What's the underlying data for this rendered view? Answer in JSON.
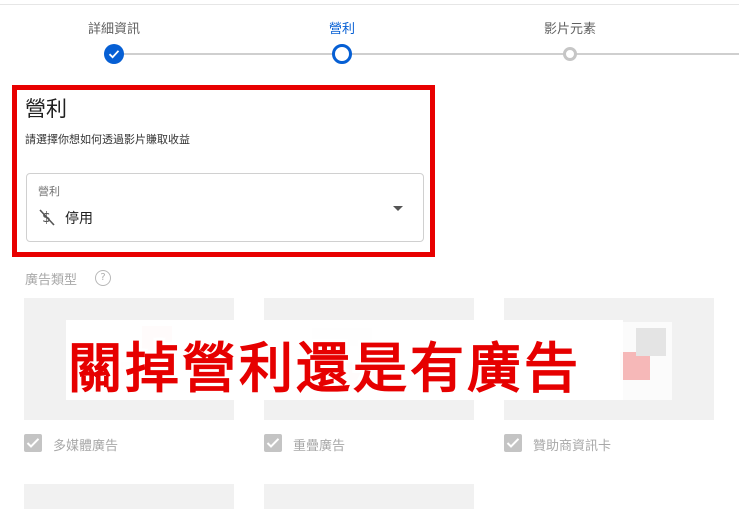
{
  "stepper": {
    "steps": [
      {
        "label": "詳細資訊",
        "state": "done"
      },
      {
        "label": "營利",
        "state": "current"
      },
      {
        "label": "影片元素",
        "state": "todo"
      }
    ]
  },
  "monetization": {
    "title": "營利",
    "description": "請選擇你想如何透過影片賺取收益",
    "select": {
      "label": "營利",
      "value": "停用",
      "icon": "monetization-off-icon"
    }
  },
  "ad_types": {
    "label": "廣告類型",
    "help_icon": "help-circle-icon",
    "options": [
      {
        "label": "多媒體廣告",
        "checked": true,
        "enabled": false
      },
      {
        "label": "重疊廣告",
        "checked": true,
        "enabled": false
      },
      {
        "label": "贊助商資訊卡",
        "checked": true,
        "enabled": false
      }
    ]
  },
  "annotation": {
    "text": "關掉營利還是有廣告",
    "color": "#e60000"
  },
  "colors": {
    "accent": "#065fd4",
    "highlight": "#e80000"
  }
}
